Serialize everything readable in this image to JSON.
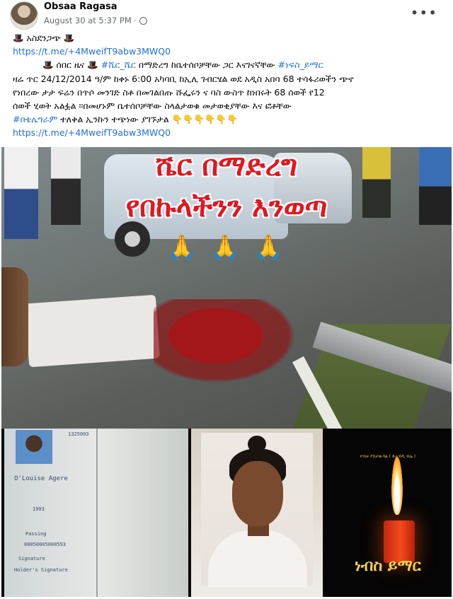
{
  "post": {
    "author": "Obsaa Ragasa",
    "timestamp": "August 30 at 5:37 PM",
    "privacy_separator": "·",
    "more_label": "•••"
  },
  "content": {
    "line1": "🎩 አስደንጋጭ 🎩",
    "link1": "https://t.me/+4MweifT9abw3MWQ0",
    "line3_a": "🎩 ሰበር ዜና 🎩 ",
    "line3_tag1": "#ሼር_ሼር",
    "line3_b": " በማድረግ ከቤተሰቦቻቸው ጋር እናገናኛቸው ",
    "line3_tag2": "#ነፍስ_ይማር",
    "line4": "ዛሬ ጥር 24/12/2014 ዓ/ም  ከቀኑ 6:00 አካባቢ ከኢሊ ገብርሄል ወደ አዲስ አበባ 68 ተሳፋሪወችን ጭኖ",
    "line5": "የነበረው ታታ ፍሬን በጥሶ መንገድ ስቶ በመገልበጡ ሹፌሩን  ና  ባስ ውስጥ ከነበሩት 68 ሰወች የ12",
    "line6": "ሰወች ሂወት አልፏል ።በመሆኑም ቤተሰቦቻቸው ስላልታወቁ መታወቂያቸው እና ፎቶቸው",
    "line7_tag": "#በቴሌግራም",
    "line7_b": " ተለቅል  ኢንኩን ተጭነው ያገኙታል ",
    "line7_emoji": "👇👇👇👇👇👇",
    "link2": "https://t.me/+4MweifT9abw3MWQ0"
  },
  "photo1": {
    "overlay_line1": "ሼር በማድረግ",
    "overlay_line2": "የበኩላችንን እንወጣ",
    "hands": "🙏 🙏 🙏"
  },
  "photo2": {
    "memorial_small": "የብቻ ያስታውሳል ( ድራብዲ ብሌ )",
    "memorial_title": "ነብስ ይማር",
    "passport_line1": "1325003",
    "passport_line2": "O'Louise Agere",
    "passport_line3": "1993",
    "passport_line4": "Passing",
    "passport_line5": "00050005000593",
    "passport_line6": "Signature",
    "passport_line7": "Holder's Signature"
  },
  "colors": {
    "link": "#216fdb",
    "overlay_red": "#e3161f",
    "candle": "#f24b1c"
  }
}
